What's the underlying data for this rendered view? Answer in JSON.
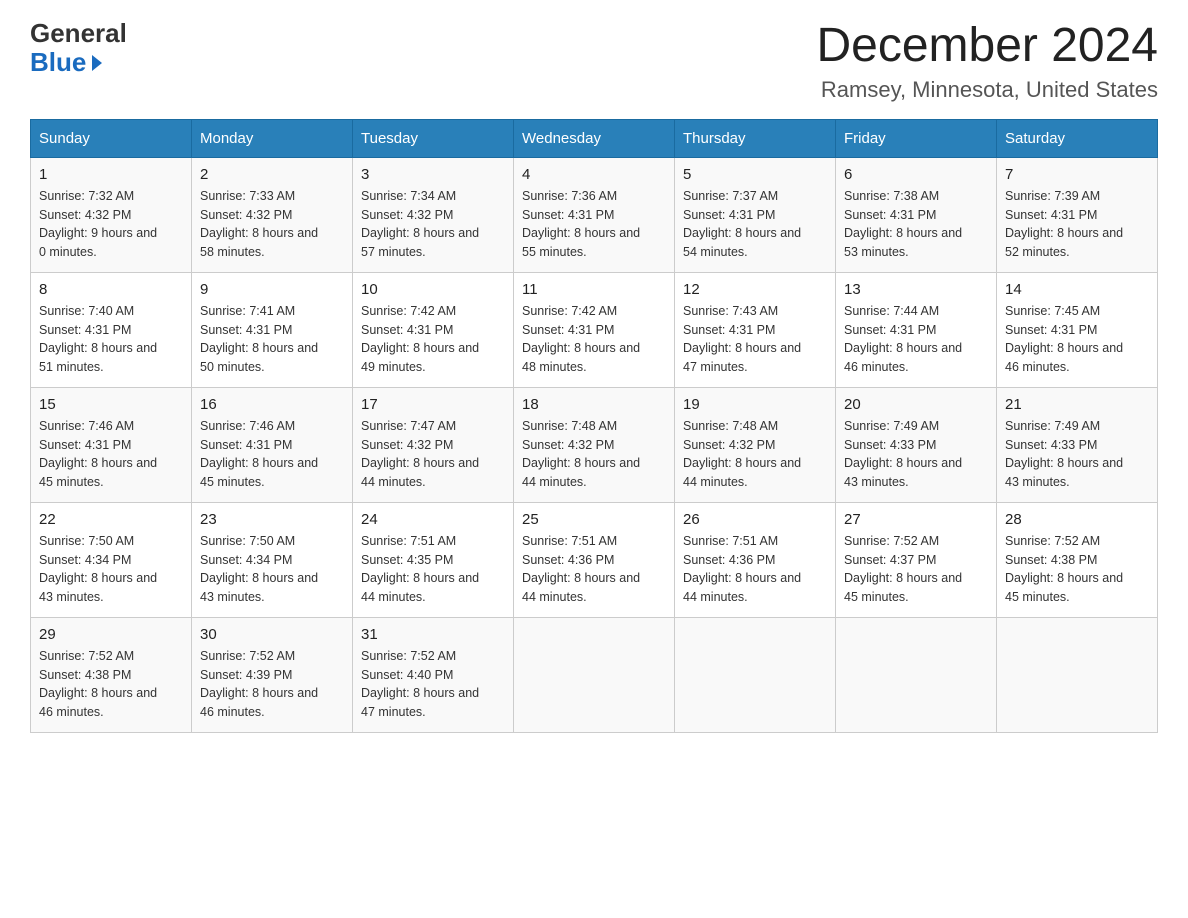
{
  "header": {
    "logo_general": "General",
    "logo_blue": "Blue",
    "month_title": "December 2024",
    "location": "Ramsey, Minnesota, United States"
  },
  "days_of_week": [
    "Sunday",
    "Monday",
    "Tuesday",
    "Wednesday",
    "Thursday",
    "Friday",
    "Saturday"
  ],
  "weeks": [
    [
      {
        "day": "1",
        "sunrise": "7:32 AM",
        "sunset": "4:32 PM",
        "daylight": "9 hours and 0 minutes."
      },
      {
        "day": "2",
        "sunrise": "7:33 AM",
        "sunset": "4:32 PM",
        "daylight": "8 hours and 58 minutes."
      },
      {
        "day": "3",
        "sunrise": "7:34 AM",
        "sunset": "4:32 PM",
        "daylight": "8 hours and 57 minutes."
      },
      {
        "day": "4",
        "sunrise": "7:36 AM",
        "sunset": "4:31 PM",
        "daylight": "8 hours and 55 minutes."
      },
      {
        "day": "5",
        "sunrise": "7:37 AM",
        "sunset": "4:31 PM",
        "daylight": "8 hours and 54 minutes."
      },
      {
        "day": "6",
        "sunrise": "7:38 AM",
        "sunset": "4:31 PM",
        "daylight": "8 hours and 53 minutes."
      },
      {
        "day": "7",
        "sunrise": "7:39 AM",
        "sunset": "4:31 PM",
        "daylight": "8 hours and 52 minutes."
      }
    ],
    [
      {
        "day": "8",
        "sunrise": "7:40 AM",
        "sunset": "4:31 PM",
        "daylight": "8 hours and 51 minutes."
      },
      {
        "day": "9",
        "sunrise": "7:41 AM",
        "sunset": "4:31 PM",
        "daylight": "8 hours and 50 minutes."
      },
      {
        "day": "10",
        "sunrise": "7:42 AM",
        "sunset": "4:31 PM",
        "daylight": "8 hours and 49 minutes."
      },
      {
        "day": "11",
        "sunrise": "7:42 AM",
        "sunset": "4:31 PM",
        "daylight": "8 hours and 48 minutes."
      },
      {
        "day": "12",
        "sunrise": "7:43 AM",
        "sunset": "4:31 PM",
        "daylight": "8 hours and 47 minutes."
      },
      {
        "day": "13",
        "sunrise": "7:44 AM",
        "sunset": "4:31 PM",
        "daylight": "8 hours and 46 minutes."
      },
      {
        "day": "14",
        "sunrise": "7:45 AM",
        "sunset": "4:31 PM",
        "daylight": "8 hours and 46 minutes."
      }
    ],
    [
      {
        "day": "15",
        "sunrise": "7:46 AM",
        "sunset": "4:31 PM",
        "daylight": "8 hours and 45 minutes."
      },
      {
        "day": "16",
        "sunrise": "7:46 AM",
        "sunset": "4:31 PM",
        "daylight": "8 hours and 45 minutes."
      },
      {
        "day": "17",
        "sunrise": "7:47 AM",
        "sunset": "4:32 PM",
        "daylight": "8 hours and 44 minutes."
      },
      {
        "day": "18",
        "sunrise": "7:48 AM",
        "sunset": "4:32 PM",
        "daylight": "8 hours and 44 minutes."
      },
      {
        "day": "19",
        "sunrise": "7:48 AM",
        "sunset": "4:32 PM",
        "daylight": "8 hours and 44 minutes."
      },
      {
        "day": "20",
        "sunrise": "7:49 AM",
        "sunset": "4:33 PM",
        "daylight": "8 hours and 43 minutes."
      },
      {
        "day": "21",
        "sunrise": "7:49 AM",
        "sunset": "4:33 PM",
        "daylight": "8 hours and 43 minutes."
      }
    ],
    [
      {
        "day": "22",
        "sunrise": "7:50 AM",
        "sunset": "4:34 PM",
        "daylight": "8 hours and 43 minutes."
      },
      {
        "day": "23",
        "sunrise": "7:50 AM",
        "sunset": "4:34 PM",
        "daylight": "8 hours and 43 minutes."
      },
      {
        "day": "24",
        "sunrise": "7:51 AM",
        "sunset": "4:35 PM",
        "daylight": "8 hours and 44 minutes."
      },
      {
        "day": "25",
        "sunrise": "7:51 AM",
        "sunset": "4:36 PM",
        "daylight": "8 hours and 44 minutes."
      },
      {
        "day": "26",
        "sunrise": "7:51 AM",
        "sunset": "4:36 PM",
        "daylight": "8 hours and 44 minutes."
      },
      {
        "day": "27",
        "sunrise": "7:52 AM",
        "sunset": "4:37 PM",
        "daylight": "8 hours and 45 minutes."
      },
      {
        "day": "28",
        "sunrise": "7:52 AM",
        "sunset": "4:38 PM",
        "daylight": "8 hours and 45 minutes."
      }
    ],
    [
      {
        "day": "29",
        "sunrise": "7:52 AM",
        "sunset": "4:38 PM",
        "daylight": "8 hours and 46 minutes."
      },
      {
        "day": "30",
        "sunrise": "7:52 AM",
        "sunset": "4:39 PM",
        "daylight": "8 hours and 46 minutes."
      },
      {
        "day": "31",
        "sunrise": "7:52 AM",
        "sunset": "4:40 PM",
        "daylight": "8 hours and 47 minutes."
      },
      null,
      null,
      null,
      null
    ]
  ]
}
